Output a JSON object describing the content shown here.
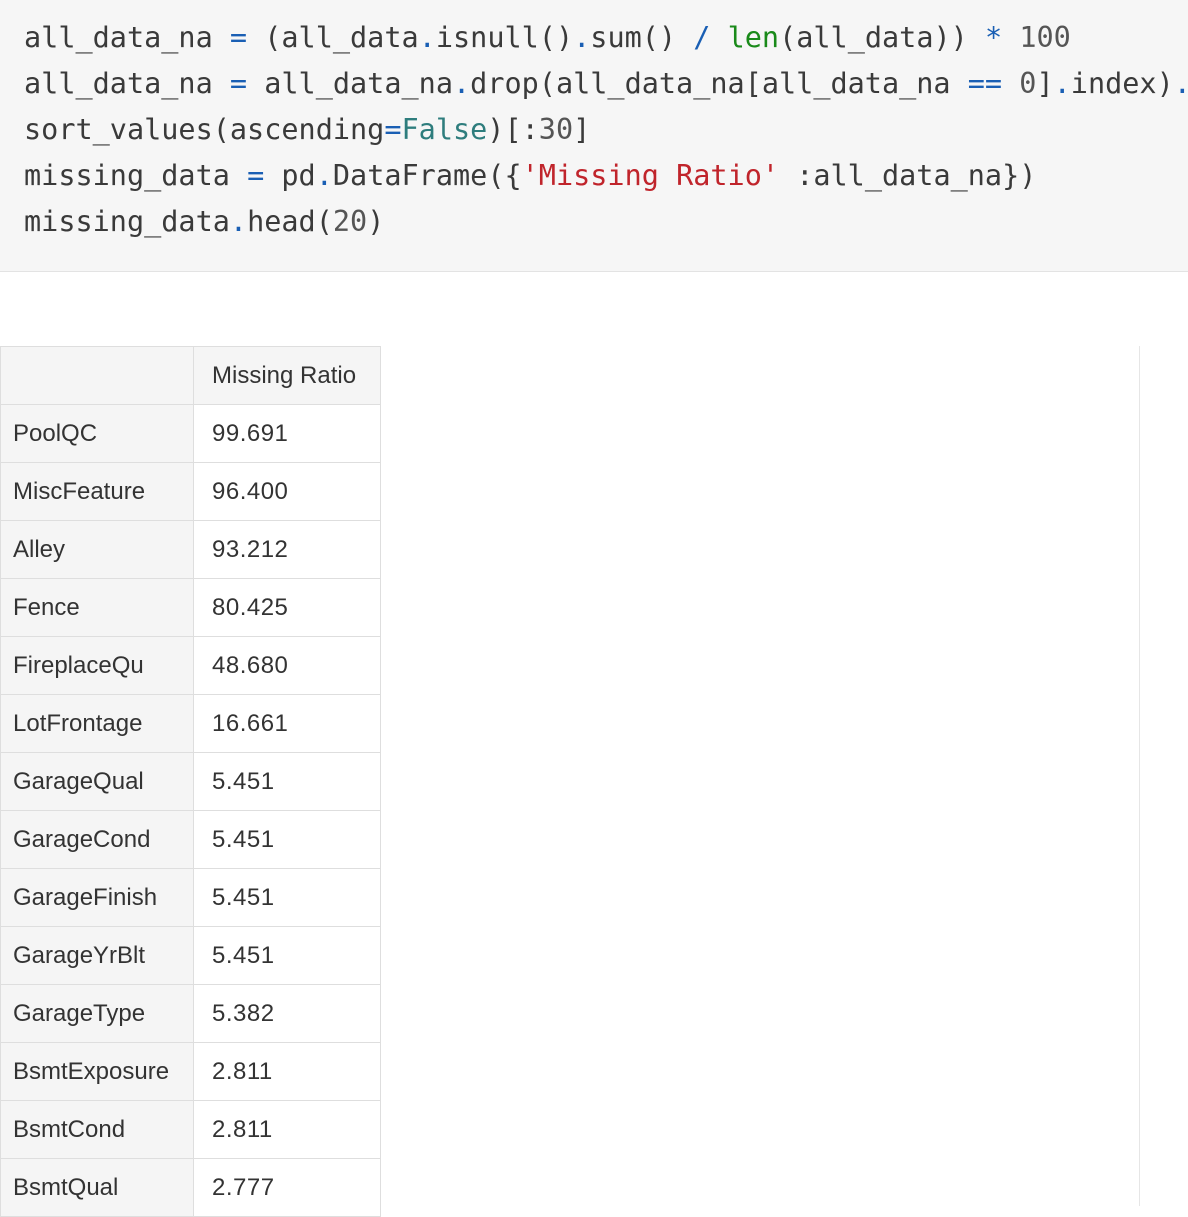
{
  "code_cell": {
    "lines": [
      [
        {
          "t": "all_data_na ",
          "c": ""
        },
        {
          "t": "=",
          "c": "tok-op"
        },
        {
          "t": " (all_data",
          "c": ""
        },
        {
          "t": ".",
          "c": "tok-op"
        },
        {
          "t": "isnull()",
          "c": ""
        },
        {
          "t": ".",
          "c": "tok-op"
        },
        {
          "t": "sum() ",
          "c": ""
        },
        {
          "t": "/",
          "c": "tok-op"
        },
        {
          "t": " ",
          "c": ""
        },
        {
          "t": "len",
          "c": "tok-builtin"
        },
        {
          "t": "(all_data)) ",
          "c": ""
        },
        {
          "t": "*",
          "c": "tok-op"
        },
        {
          "t": " ",
          "c": ""
        },
        {
          "t": "100",
          "c": "tok-num"
        }
      ],
      [
        {
          "t": "all_data_na ",
          "c": ""
        },
        {
          "t": "=",
          "c": "tok-op"
        },
        {
          "t": " all_data_na",
          "c": ""
        },
        {
          "t": ".",
          "c": "tok-op"
        },
        {
          "t": "drop(all_data_na[all_data_na ",
          "c": ""
        },
        {
          "t": "==",
          "c": "tok-op"
        },
        {
          "t": " ",
          "c": ""
        },
        {
          "t": "0",
          "c": "tok-num"
        },
        {
          "t": "]",
          "c": ""
        },
        {
          "t": ".",
          "c": "tok-op"
        },
        {
          "t": "index)",
          "c": ""
        },
        {
          "t": ".",
          "c": "tok-op"
        }
      ],
      [
        {
          "t": "sort_values(ascending",
          "c": ""
        },
        {
          "t": "=",
          "c": "tok-op"
        },
        {
          "t": "False",
          "c": "tok-kw"
        },
        {
          "t": ")[:",
          "c": ""
        },
        {
          "t": "30",
          "c": "tok-num"
        },
        {
          "t": "]",
          "c": ""
        }
      ],
      [
        {
          "t": "missing_data ",
          "c": ""
        },
        {
          "t": "=",
          "c": "tok-op"
        },
        {
          "t": " pd",
          "c": ""
        },
        {
          "t": ".",
          "c": "tok-op"
        },
        {
          "t": "DataFrame({",
          "c": ""
        },
        {
          "t": "'Missing Ratio'",
          "c": "tok-str"
        },
        {
          "t": " :all_data_na})",
          "c": ""
        }
      ],
      [
        {
          "t": "missing_data",
          "c": ""
        },
        {
          "t": ".",
          "c": "tok-op"
        },
        {
          "t": "head(",
          "c": ""
        },
        {
          "t": "20",
          "c": "tok-num"
        },
        {
          "t": ")",
          "c": ""
        }
      ]
    ]
  },
  "output_table": {
    "index_header": "",
    "column_header": "Missing Ratio",
    "rows": [
      {
        "index": "PoolQC",
        "value": "99.691"
      },
      {
        "index": "MiscFeature",
        "value": "96.400"
      },
      {
        "index": "Alley",
        "value": "93.212"
      },
      {
        "index": "Fence",
        "value": "80.425"
      },
      {
        "index": "FireplaceQu",
        "value": "48.680"
      },
      {
        "index": "LotFrontage",
        "value": "16.661"
      },
      {
        "index": "GarageQual",
        "value": "5.451"
      },
      {
        "index": "GarageCond",
        "value": "5.451"
      },
      {
        "index": "GarageFinish",
        "value": "5.451"
      },
      {
        "index": "GarageYrBlt",
        "value": "5.451"
      },
      {
        "index": "GarageType",
        "value": "5.382"
      },
      {
        "index": "BsmtExposure",
        "value": "2.811"
      },
      {
        "index": "BsmtCond",
        "value": "2.811"
      },
      {
        "index": "BsmtQual",
        "value": "2.777"
      }
    ]
  }
}
